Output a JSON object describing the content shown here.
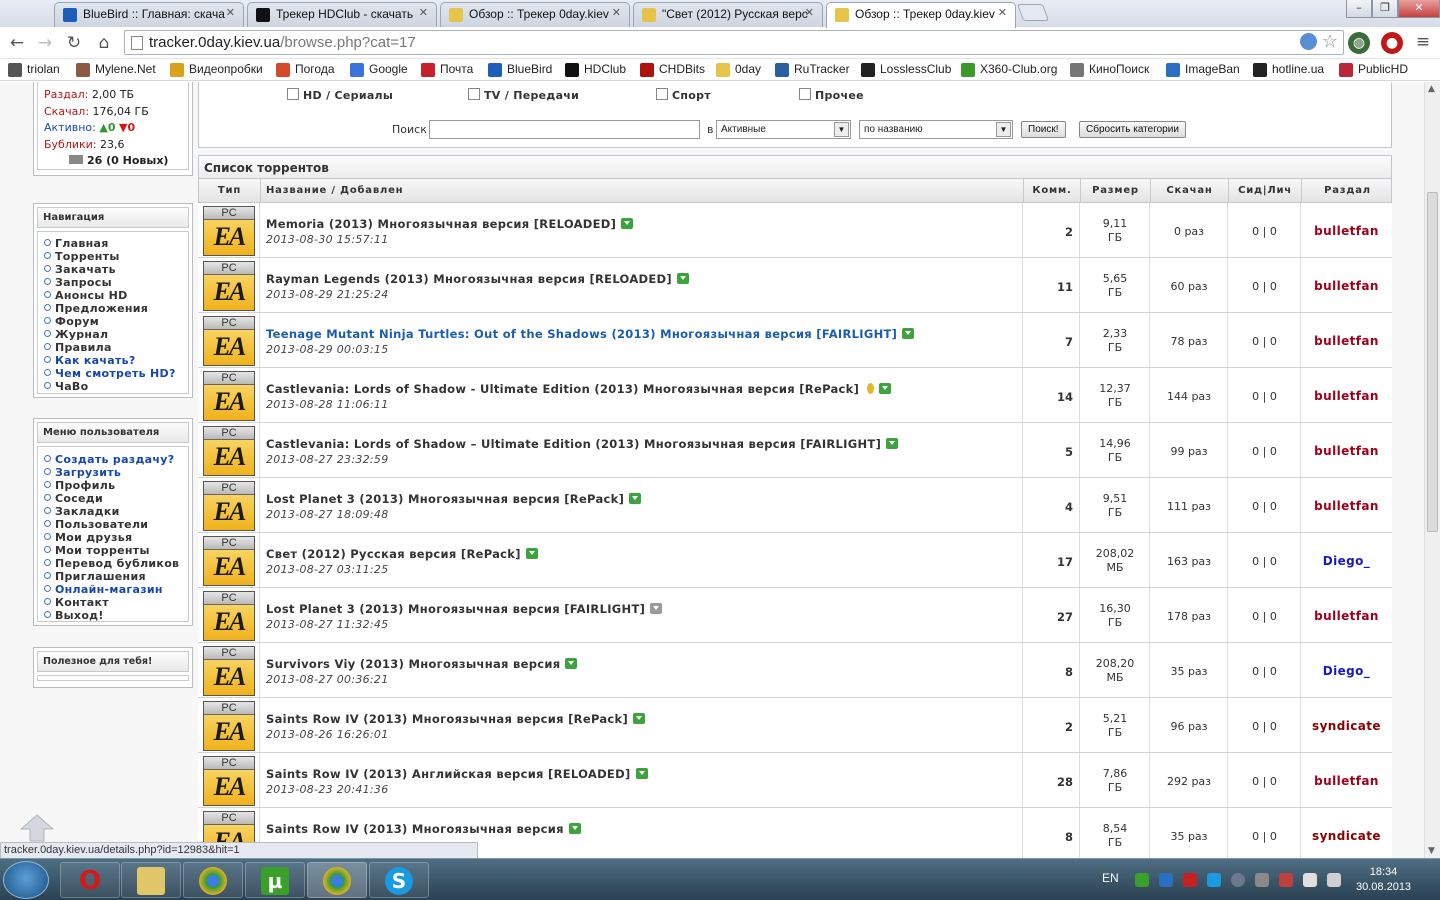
{
  "browser": {
    "tabs": [
      {
        "title": "BlueBird :: Главная: скача",
        "color": "#1d5fb8"
      },
      {
        "title": "Трекер HDClub - скачать",
        "color": "#111111"
      },
      {
        "title": "Обзор :: Трекер 0day.kiev",
        "color": "#e6c34a"
      },
      {
        "title": "\"Свет (2012) Русская верс",
        "color": "#e6c34a"
      },
      {
        "title": "Обзор :: Трекер 0day.kiev",
        "color": "#e6c34a"
      }
    ],
    "url_host": "tracker.0day.kiev.ua",
    "url_path": "/browse.php?cat=17",
    "bookmarks": [
      {
        "label": "triolan",
        "color": "#555555"
      },
      {
        "label": "Mylene.Net",
        "color": "#8a5a44"
      },
      {
        "label": "Видеопробки",
        "color": "#d9a21b"
      },
      {
        "label": "Погода",
        "color": "#d24a2a"
      },
      {
        "label": "Google",
        "color": "#3b74d8"
      },
      {
        "label": "Почта",
        "color": "#c7202a"
      },
      {
        "label": "BlueBird",
        "color": "#1d5fb8"
      },
      {
        "label": "HDClub",
        "color": "#111111"
      },
      {
        "label": "CHDBits",
        "color": "#b01010"
      },
      {
        "label": "0day",
        "color": "#e6c34a"
      },
      {
        "label": "RuTracker",
        "color": "#2a5fa0"
      },
      {
        "label": "LosslessClub",
        "color": "#222222"
      },
      {
        "label": "X360-Club.org",
        "color": "#3c9a2a"
      },
      {
        "label": "КиноПоиск",
        "color": "#777777"
      },
      {
        "label": "ImageBan",
        "color": "#2a6fc0"
      },
      {
        "label": "hotline.ua",
        "color": "#222222"
      },
      {
        "label": "PublicHD",
        "color": "#b8283a"
      }
    ]
  },
  "userstats": {
    "upload_label": "Раздал:",
    "upload": "2,00 ТБ",
    "download_label": "Скачал:",
    "download": "176,04 ГБ",
    "active_label": "Активно:",
    "seeding": "0",
    "leeching": "0",
    "bonus_label": "Бублики:",
    "bonus": "23,6",
    "messages": "26 (0 Новых)"
  },
  "navigation": {
    "title": "Навигация",
    "items": [
      "Главная",
      "Торренты",
      "Закачать",
      "Запросы",
      "Анонсы HD",
      "Предложения",
      "Форум",
      "Журнал",
      "Правила",
      "Как качать?",
      "Чем смотреть HD?",
      "ЧаВо"
    ]
  },
  "user_menu": {
    "title": "Меню пользователя",
    "items": [
      "Создать раздачу?",
      "Загрузить",
      "Профиль",
      "Соседи",
      "Закладки",
      "Пользователи",
      "Мои друзья",
      "Мои торренты",
      "Перевод бубликов",
      "Приглашения",
      "Онлайн-магазин",
      "Контакт",
      "Выход!"
    ]
  },
  "useful": {
    "title": "Полезное для тебя!"
  },
  "filter": {
    "categories": [
      "HD / Сериалы",
      "TV / Передачи",
      "Спорт",
      "Прочее"
    ],
    "search_label": "Поиск",
    "in_label": "в",
    "scope": "Активные",
    "sort": "по названию",
    "search_button": "Поиск!",
    "reset_button": "Сбросить категории"
  },
  "list": {
    "title": "Список торрентов",
    "headers": [
      "Тип",
      "Название / Добавлен",
      "Комм.",
      "Размер",
      "Скачан",
      "Сид|Лич",
      "Раздал"
    ],
    "type_top": "PC",
    "type_logo": "EA",
    "rows": [
      {
        "name": "Memoria (2013) Многоязычная версия [RELOADED]",
        "date": "2013-08-30 15:57:11",
        "comments": "2",
        "size": "9,11",
        "unit": "ГБ",
        "snatched": "0 раз",
        "peers": "0 | 0",
        "uploader": "bulletfan",
        "ucolor": "#a0001a"
      },
      {
        "name": "Rayman Legends (2013) Многоязычная версия [RELOADED]",
        "date": "2013-08-29 21:25:24",
        "comments": "11",
        "size": "5,65",
        "unit": "ГБ",
        "snatched": "60 раз",
        "peers": "0 | 0",
        "uploader": "bulletfan",
        "ucolor": "#a0001a"
      },
      {
        "name": "Teenage Mutant Ninja Turtles: Out of the Shadows (2013) Многоязычная версия [FAIRLIGHT]",
        "date": "2013-08-29 00:03:15",
        "comments": "7",
        "size": "2,33",
        "unit": "ГБ",
        "snatched": "78 раз",
        "peers": "0 | 0",
        "uploader": "bulletfan",
        "ucolor": "#a0001a",
        "hover": true
      },
      {
        "name": "Castlevania: Lords of Shadow - Ultimate Edition (2013) Многоязычная версия [RePack]",
        "date": "2013-08-28 11:06:11",
        "comments": "14",
        "size": "12,37",
        "unit": "ГБ",
        "snatched": "144 раз",
        "peers": "0 | 0",
        "uploader": "bulletfan",
        "ucolor": "#a0001a",
        "coin": true
      },
      {
        "name": "Castlevania: Lords of Shadow – Ultimate Edition (2013) Многоязычная версия [FAIRLIGHT]",
        "date": "2013-08-27 23:32:59",
        "comments": "5",
        "size": "14,96",
        "unit": "ГБ",
        "snatched": "99 раз",
        "peers": "0 | 0",
        "uploader": "bulletfan",
        "ucolor": "#a0001a"
      },
      {
        "name": "Lost Planet 3 (2013) Многоязычная версия [RePack]",
        "date": "2013-08-27 18:09:48",
        "comments": "4",
        "size": "9,51",
        "unit": "ГБ",
        "snatched": "111 раз",
        "peers": "0 | 0",
        "uploader": "bulletfan",
        "ucolor": "#a0001a"
      },
      {
        "name": "Свет (2012) Русская версия [RePack]",
        "date": "2013-08-27 03:11:25",
        "comments": "17",
        "size": "208,02",
        "unit": "МБ",
        "snatched": "163 раз",
        "peers": "0 | 0",
        "uploader": "Diego_",
        "ucolor": "#1a1ab8"
      },
      {
        "name": "Lost Planet 3 (2013) Многоязычная версия [FAIRLIGHT]",
        "date": "2013-08-27 11:32:45",
        "comments": "27",
        "size": "16,30",
        "unit": "ГБ",
        "snatched": "178 раз",
        "peers": "0 | 0",
        "uploader": "bulletfan",
        "ucolor": "#a0001a",
        "gray": true
      },
      {
        "name": "Survivors Viy (2013) Многоязычная версия",
        "date": "2013-08-27 00:36:21",
        "comments": "8",
        "size": "208,20",
        "unit": "МБ",
        "snatched": "35 раз",
        "peers": "0 | 0",
        "uploader": "Diego_",
        "ucolor": "#1a1ab8"
      },
      {
        "name": "Saints Row IV (2013) Многоязычная версия [RePack]",
        "date": "2013-08-26 16:26:01",
        "comments": "2",
        "size": "5,21",
        "unit": "ГБ",
        "snatched": "96 раз",
        "peers": "0 | 0",
        "uploader": "syndicate",
        "ucolor": "#8b0000"
      },
      {
        "name": "Saints Row IV (2013) Английская версия [RELOADED]",
        "date": "2013-08-23 20:41:36",
        "comments": "28",
        "size": "7,86",
        "unit": "ГБ",
        "snatched": "292 раз",
        "peers": "0 | 0",
        "uploader": "bulletfan",
        "ucolor": "#a0001a"
      },
      {
        "name": "Saints Row IV (2013) Многоязычная версия",
        "date": "",
        "comments": "8",
        "size": "8,54",
        "unit": "ГБ",
        "snatched": "35 раз",
        "peers": "0 | 0",
        "uploader": "syndicate",
        "ucolor": "#8b0000"
      }
    ]
  },
  "status_url": "tracker.0day.kiev.ua/details.php?id=12983&hit=1",
  "taskbar": {
    "lang": "EN",
    "time": "18:34",
    "date": "30.08.2013"
  }
}
